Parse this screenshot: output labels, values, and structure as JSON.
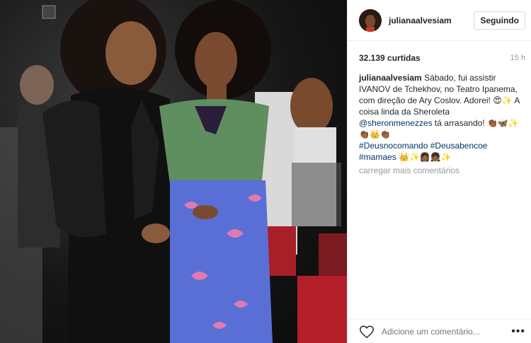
{
  "post": {
    "username": "julianaalvesiam",
    "follow_label": "Seguindo",
    "likes": "32.139 curtidas",
    "time": "15 h",
    "caption": {
      "user": "julianaalvesiam",
      "text1": "Sábado, fui assistir IVANOV de Tchekhov, no Teatro Ipanema, com direção de Ary Coslov. Adorei! 😍✨ A coisa linda da Sheroleta",
      "mention": "@sheronmenezzes",
      "text2": "tá arrasando! 👏🏾🦋✨ 👏🏾👑👏🏾",
      "hashtag1": "#Deusnocomando",
      "hashtag2": "#Deusabencoe",
      "hashtag3": "#mamaes",
      "text3": "👑✨👩🏾‍👧🏾✨"
    },
    "load_more": "carregar mais comentários",
    "comment_placeholder": "Adicione um comentário...",
    "more_icon": "•••"
  },
  "icons": {
    "heart": "heart-icon",
    "more": "more-options-icon"
  }
}
